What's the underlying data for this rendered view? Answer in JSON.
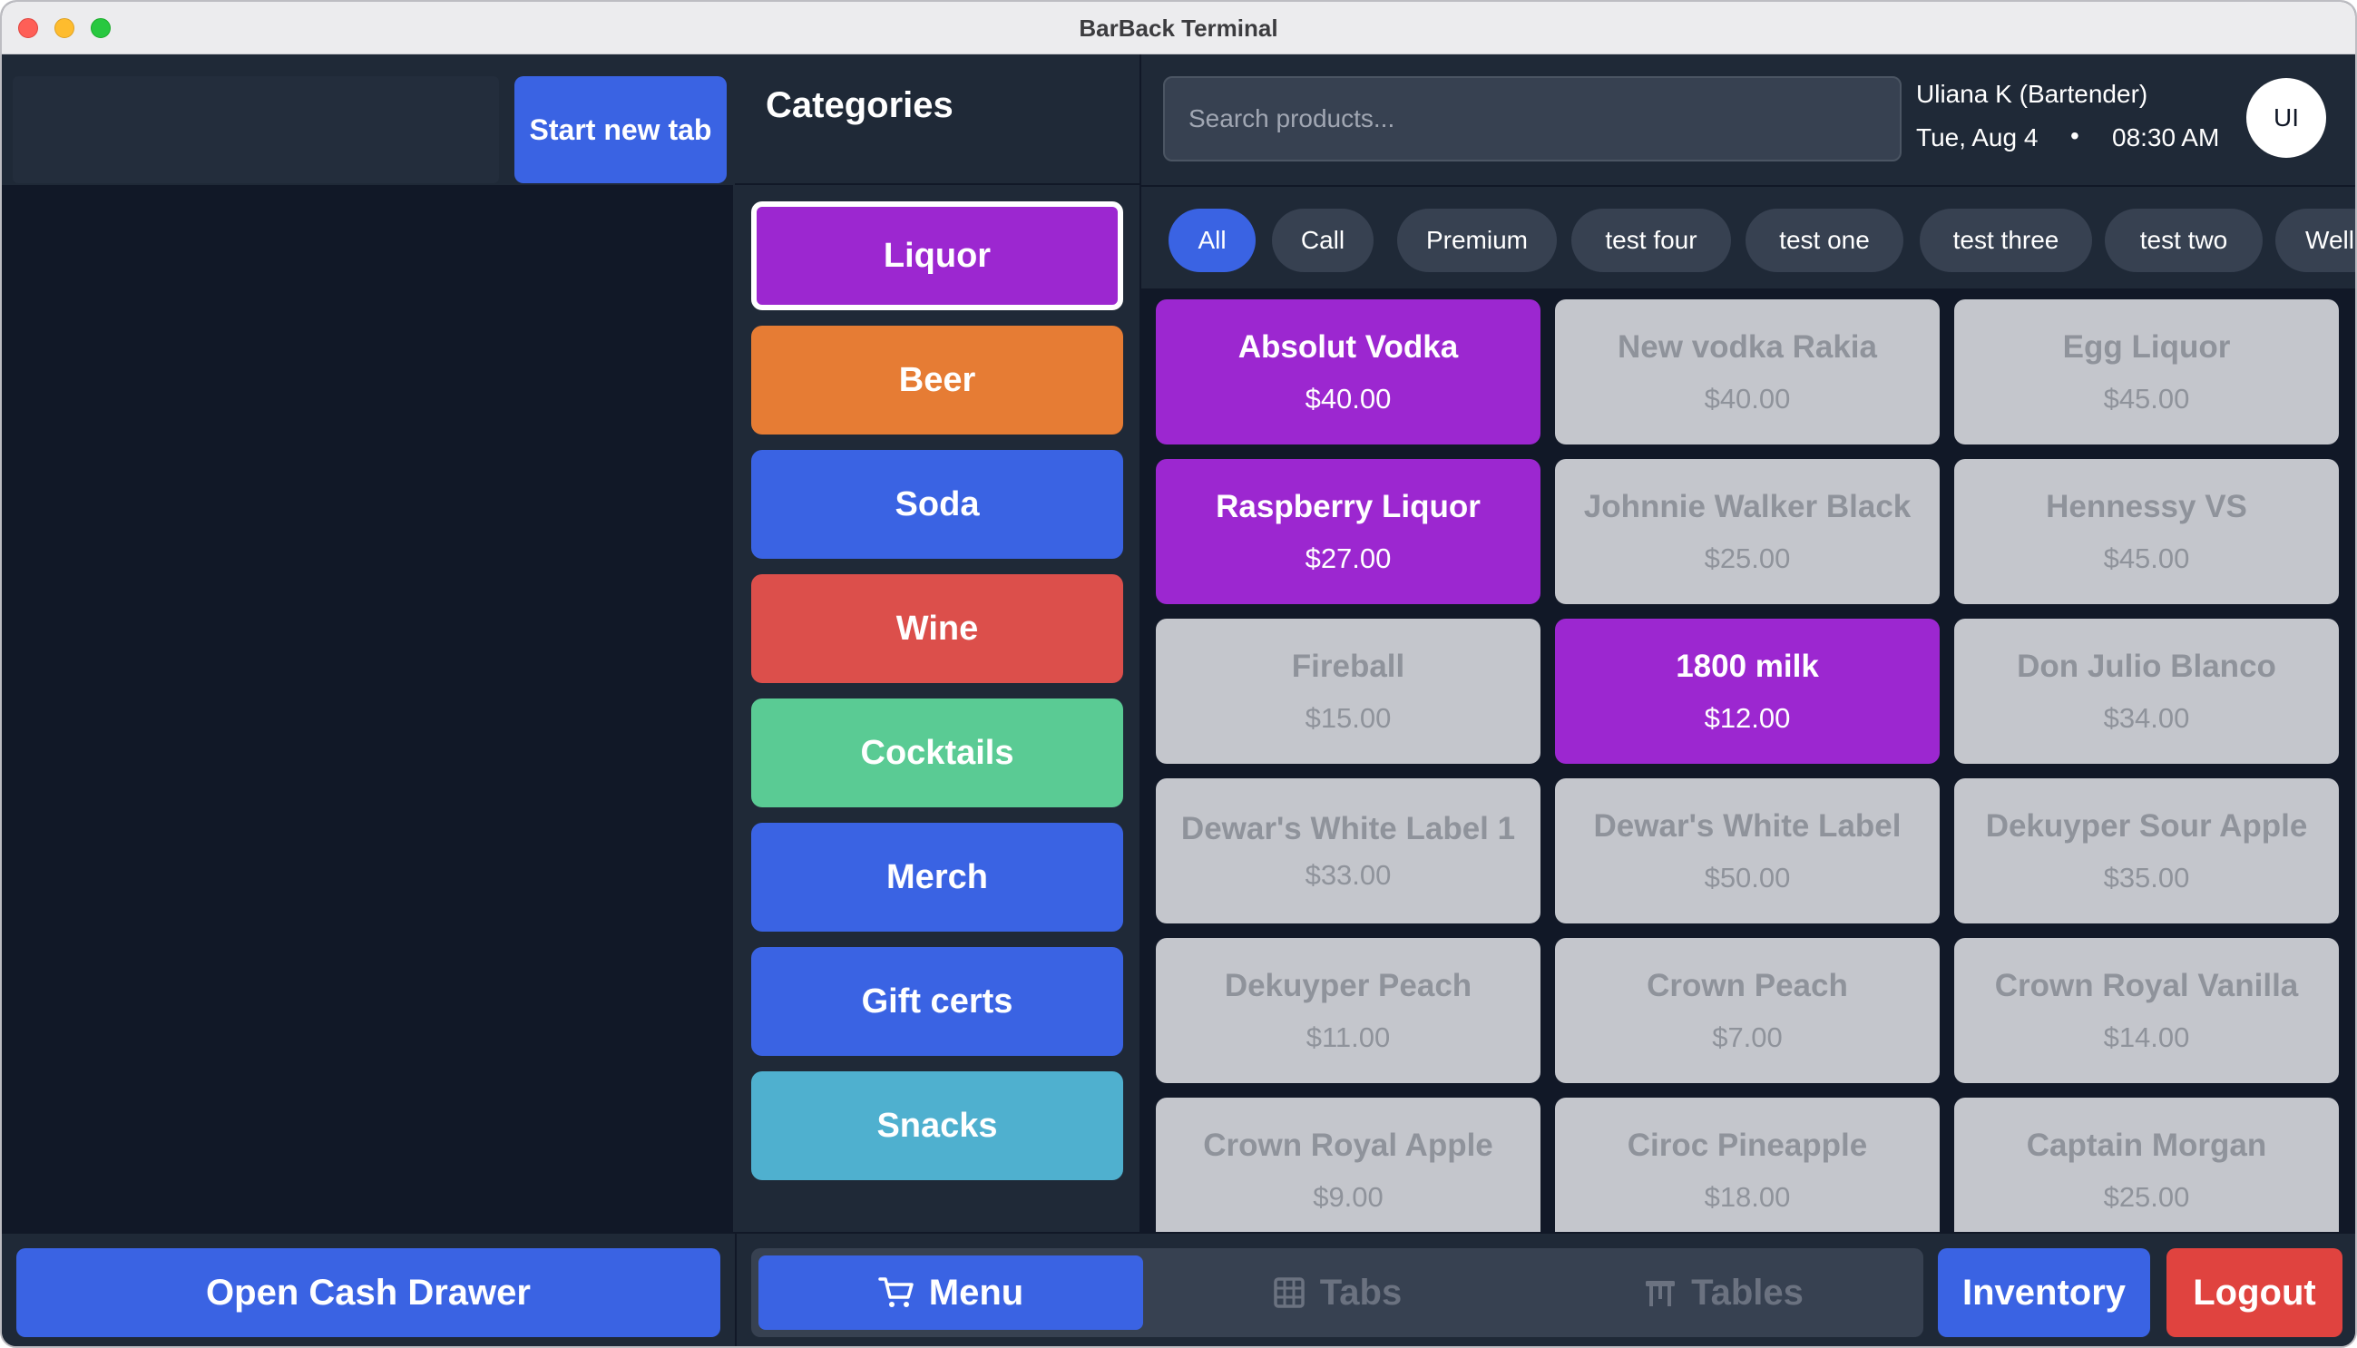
{
  "window": {
    "title": "BarBack Terminal"
  },
  "left_panel": {
    "start_tab_label": "Start new tab",
    "open_cash_drawer_label": "Open Cash Drawer"
  },
  "categories": {
    "title": "Categories",
    "items": [
      {
        "label": "Liquor",
        "color": "#9c27d0",
        "selected": true
      },
      {
        "label": "Beer",
        "color": "#e67c34",
        "selected": false
      },
      {
        "label": "Soda",
        "color": "#3a63e3",
        "selected": false
      },
      {
        "label": "Wine",
        "color": "#dc4f4b",
        "selected": false
      },
      {
        "label": "Cocktails",
        "color": "#5acb94",
        "selected": false
      },
      {
        "label": "Merch",
        "color": "#3a63e3",
        "selected": false
      },
      {
        "label": "Gift certs",
        "color": "#3a63e3",
        "selected": false
      },
      {
        "label": "Snacks",
        "color": "#4fb0cf",
        "selected": false
      }
    ]
  },
  "header": {
    "search_placeholder": "Search products...",
    "user_name": "Uliana K (Bartender)",
    "date": "Tue, Aug 4",
    "separator": "•",
    "time": "08:30 AM",
    "avatar_initials": "UI"
  },
  "filters": {
    "items": [
      {
        "label": "All",
        "active": true
      },
      {
        "label": "Call",
        "active": false
      },
      {
        "label": "Premium",
        "active": false
      },
      {
        "label": "test four",
        "active": false
      },
      {
        "label": "test one",
        "active": false
      },
      {
        "label": "test three",
        "active": false
      },
      {
        "label": "test two",
        "active": false
      },
      {
        "label": "Well",
        "active": false
      }
    ]
  },
  "products": [
    {
      "name": "Absolut Vodka",
      "price": "$40.00",
      "style": "purple"
    },
    {
      "name": "New vodka Rakia",
      "price": "$40.00",
      "style": "grey"
    },
    {
      "name": "Egg Liquor",
      "price": "$45.00",
      "style": "grey"
    },
    {
      "name": "Raspberry Liquor",
      "price": "$27.00",
      "style": "purple"
    },
    {
      "name": "Johnnie Walker Black",
      "price": "$25.00",
      "style": "grey"
    },
    {
      "name": "Hennessy VS",
      "price": "$45.00",
      "style": "grey"
    },
    {
      "name": "Fireball",
      "price": "$15.00",
      "style": "grey"
    },
    {
      "name": "1800 milk",
      "price": "$12.00",
      "style": "purple"
    },
    {
      "name": "Don Julio Blanco",
      "price": "$34.00",
      "style": "grey"
    },
    {
      "name": "Dewar's White Label 1",
      "price": "$33.00",
      "style": "grey"
    },
    {
      "name": "Dewar's White Label",
      "price": "$50.00",
      "style": "grey"
    },
    {
      "name": "Dekuyper Sour Apple",
      "price": "$35.00",
      "style": "grey"
    },
    {
      "name": "Dekuyper Peach",
      "price": "$11.00",
      "style": "grey"
    },
    {
      "name": "Crown Peach",
      "price": "$7.00",
      "style": "grey"
    },
    {
      "name": "Crown Royal Vanilla",
      "price": "$14.00",
      "style": "grey"
    },
    {
      "name": "Crown Royal Apple",
      "price": "$9.00",
      "style": "grey"
    },
    {
      "name": "Ciroc Pineapple",
      "price": "$18.00",
      "style": "grey"
    },
    {
      "name": "Captain Morgan",
      "price": "$25.00",
      "style": "grey"
    }
  ],
  "bottom_nav": {
    "tabs": [
      {
        "label": "Menu",
        "icon": "cart-icon",
        "active": true
      },
      {
        "label": "Tabs",
        "icon": "grid-icon",
        "active": false
      },
      {
        "label": "Tables",
        "icon": "table-icon",
        "active": false
      }
    ],
    "inventory_label": "Inventory",
    "logout_label": "Logout"
  }
}
